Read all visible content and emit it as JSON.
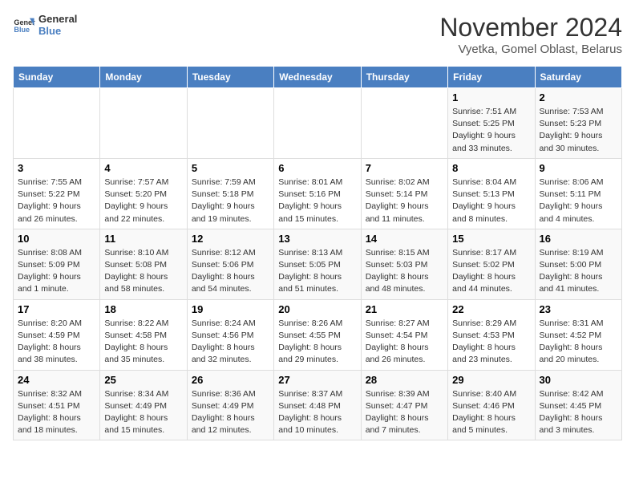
{
  "logo": {
    "line1": "General",
    "line2": "Blue"
  },
  "title": "November 2024",
  "subtitle": "Vyetka, Gomel Oblast, Belarus",
  "headers": [
    "Sunday",
    "Monday",
    "Tuesday",
    "Wednesday",
    "Thursday",
    "Friday",
    "Saturday"
  ],
  "weeks": [
    [
      {
        "day": "",
        "info": ""
      },
      {
        "day": "",
        "info": ""
      },
      {
        "day": "",
        "info": ""
      },
      {
        "day": "",
        "info": ""
      },
      {
        "day": "",
        "info": ""
      },
      {
        "day": "1",
        "info": "Sunrise: 7:51 AM\nSunset: 5:25 PM\nDaylight: 9 hours\nand 33 minutes."
      },
      {
        "day": "2",
        "info": "Sunrise: 7:53 AM\nSunset: 5:23 PM\nDaylight: 9 hours\nand 30 minutes."
      }
    ],
    [
      {
        "day": "3",
        "info": "Sunrise: 7:55 AM\nSunset: 5:22 PM\nDaylight: 9 hours\nand 26 minutes."
      },
      {
        "day": "4",
        "info": "Sunrise: 7:57 AM\nSunset: 5:20 PM\nDaylight: 9 hours\nand 22 minutes."
      },
      {
        "day": "5",
        "info": "Sunrise: 7:59 AM\nSunset: 5:18 PM\nDaylight: 9 hours\nand 19 minutes."
      },
      {
        "day": "6",
        "info": "Sunrise: 8:01 AM\nSunset: 5:16 PM\nDaylight: 9 hours\nand 15 minutes."
      },
      {
        "day": "7",
        "info": "Sunrise: 8:02 AM\nSunset: 5:14 PM\nDaylight: 9 hours\nand 11 minutes."
      },
      {
        "day": "8",
        "info": "Sunrise: 8:04 AM\nSunset: 5:13 PM\nDaylight: 9 hours\nand 8 minutes."
      },
      {
        "day": "9",
        "info": "Sunrise: 8:06 AM\nSunset: 5:11 PM\nDaylight: 9 hours\nand 4 minutes."
      }
    ],
    [
      {
        "day": "10",
        "info": "Sunrise: 8:08 AM\nSunset: 5:09 PM\nDaylight: 9 hours\nand 1 minute."
      },
      {
        "day": "11",
        "info": "Sunrise: 8:10 AM\nSunset: 5:08 PM\nDaylight: 8 hours\nand 58 minutes."
      },
      {
        "day": "12",
        "info": "Sunrise: 8:12 AM\nSunset: 5:06 PM\nDaylight: 8 hours\nand 54 minutes."
      },
      {
        "day": "13",
        "info": "Sunrise: 8:13 AM\nSunset: 5:05 PM\nDaylight: 8 hours\nand 51 minutes."
      },
      {
        "day": "14",
        "info": "Sunrise: 8:15 AM\nSunset: 5:03 PM\nDaylight: 8 hours\nand 48 minutes."
      },
      {
        "day": "15",
        "info": "Sunrise: 8:17 AM\nSunset: 5:02 PM\nDaylight: 8 hours\nand 44 minutes."
      },
      {
        "day": "16",
        "info": "Sunrise: 8:19 AM\nSunset: 5:00 PM\nDaylight: 8 hours\nand 41 minutes."
      }
    ],
    [
      {
        "day": "17",
        "info": "Sunrise: 8:20 AM\nSunset: 4:59 PM\nDaylight: 8 hours\nand 38 minutes."
      },
      {
        "day": "18",
        "info": "Sunrise: 8:22 AM\nSunset: 4:58 PM\nDaylight: 8 hours\nand 35 minutes."
      },
      {
        "day": "19",
        "info": "Sunrise: 8:24 AM\nSunset: 4:56 PM\nDaylight: 8 hours\nand 32 minutes."
      },
      {
        "day": "20",
        "info": "Sunrise: 8:26 AM\nSunset: 4:55 PM\nDaylight: 8 hours\nand 29 minutes."
      },
      {
        "day": "21",
        "info": "Sunrise: 8:27 AM\nSunset: 4:54 PM\nDaylight: 8 hours\nand 26 minutes."
      },
      {
        "day": "22",
        "info": "Sunrise: 8:29 AM\nSunset: 4:53 PM\nDaylight: 8 hours\nand 23 minutes."
      },
      {
        "day": "23",
        "info": "Sunrise: 8:31 AM\nSunset: 4:52 PM\nDaylight: 8 hours\nand 20 minutes."
      }
    ],
    [
      {
        "day": "24",
        "info": "Sunrise: 8:32 AM\nSunset: 4:51 PM\nDaylight: 8 hours\nand 18 minutes."
      },
      {
        "day": "25",
        "info": "Sunrise: 8:34 AM\nSunset: 4:49 PM\nDaylight: 8 hours\nand 15 minutes."
      },
      {
        "day": "26",
        "info": "Sunrise: 8:36 AM\nSunset: 4:49 PM\nDaylight: 8 hours\nand 12 minutes."
      },
      {
        "day": "27",
        "info": "Sunrise: 8:37 AM\nSunset: 4:48 PM\nDaylight: 8 hours\nand 10 minutes."
      },
      {
        "day": "28",
        "info": "Sunrise: 8:39 AM\nSunset: 4:47 PM\nDaylight: 8 hours\nand 7 minutes."
      },
      {
        "day": "29",
        "info": "Sunrise: 8:40 AM\nSunset: 4:46 PM\nDaylight: 8 hours\nand 5 minutes."
      },
      {
        "day": "30",
        "info": "Sunrise: 8:42 AM\nSunset: 4:45 PM\nDaylight: 8 hours\nand 3 minutes."
      }
    ]
  ]
}
